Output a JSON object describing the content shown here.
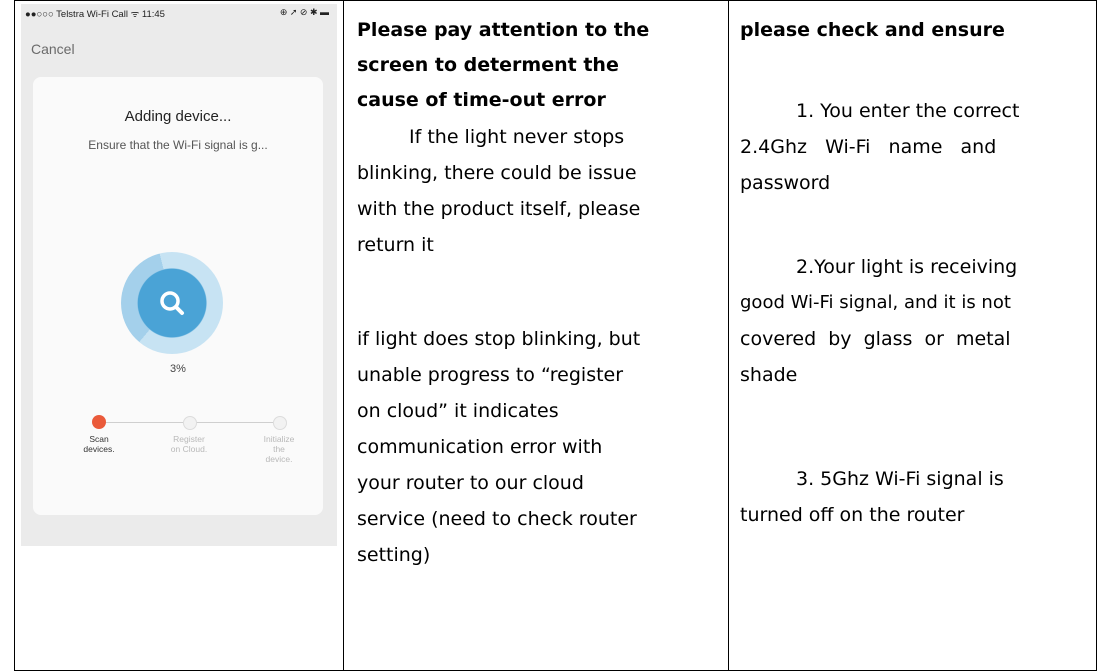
{
  "phone": {
    "status_left": "●●○○○ Telstra Wi-Fi Call ᯤ  11:45",
    "status_right": "⊕ ➚ ⊘ ✱ ▬",
    "cancel": "Cancel",
    "title": "Adding device...",
    "subtitle": "Ensure that the Wi-Fi signal is g...",
    "progress_percent": "3%",
    "progress_value": 0.03,
    "steps": [
      {
        "label_1": "Scan",
        "label_2": "devices.",
        "label_3": "",
        "state": "active"
      },
      {
        "label_1": "Register",
        "label_2": "on Cloud.",
        "label_3": "",
        "state": "idle"
      },
      {
        "label_1": "Initialize",
        "label_2": "the",
        "label_3": "device.",
        "state": "idle"
      }
    ],
    "colors": {
      "accent": "#4aa3d6",
      "active_step": "#ea5a3a"
    }
  },
  "col2": {
    "heading": [
      "Please pay attention to the",
      "screen to determent the",
      "cause of time-out error"
    ],
    "para1": [
      "If the light never stops",
      "blinking, there could be issue",
      "with the product itself, please",
      "return it"
    ],
    "para2": [
      "if light does stop blinking, but",
      "unable progress to “register",
      "on cloud”    it indicates",
      "communication error with",
      "your router to our cloud",
      "service (need to check router",
      "setting)"
    ]
  },
  "col3": {
    "heading": "please check and ensure",
    "item1": [
      "1. You enter the correct",
      "2.4Ghz   Wi-Fi   name   and",
      "password"
    ],
    "item2": [
      "2.Your light is receiving",
      "good Wi-Fi signal, and it is not",
      "covered  by  glass  or  metal",
      "shade"
    ],
    "item3": [
      "3. 5Ghz Wi-Fi signal is",
      "turned off on the router"
    ]
  }
}
